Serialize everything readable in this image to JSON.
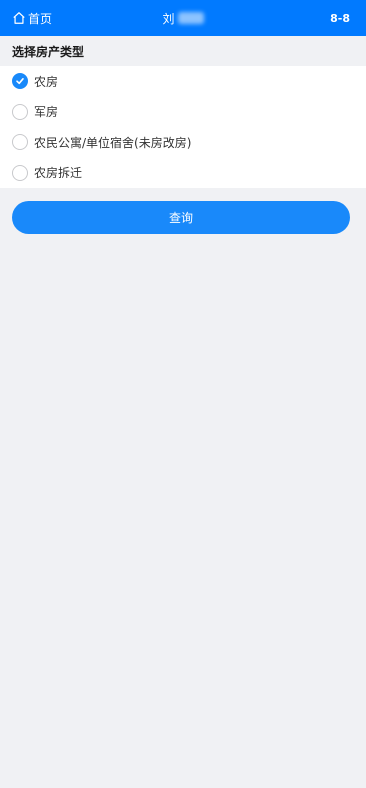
{
  "header": {
    "home_label": "首页",
    "title": "刘",
    "badge": "8-8",
    "bg_color": "#017aff"
  },
  "section": {
    "title": "选择房产类型"
  },
  "options": [
    {
      "label": "农房",
      "checked": true
    },
    {
      "label": "军房",
      "checked": false
    },
    {
      "label": "农民公寓/单位宿舍(未房改房)",
      "checked": false
    },
    {
      "label": "农房拆迁",
      "checked": false
    }
  ],
  "query_button": {
    "label": "查询",
    "color": "#1989fa"
  }
}
